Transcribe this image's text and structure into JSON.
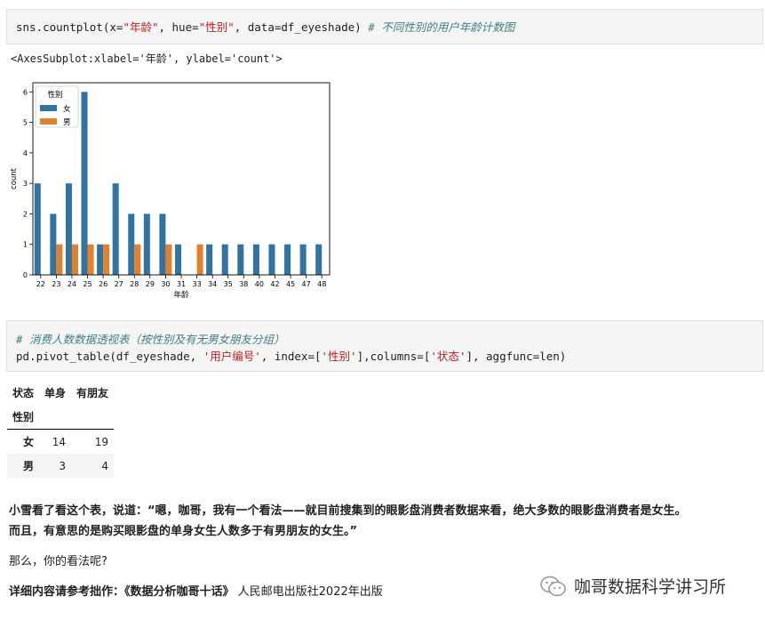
{
  "cell1": {
    "code_prefix": "sns.countplot(x=",
    "str_x": "\"年龄\"",
    "code_mid1": ", hue=",
    "str_hue": "\"性别\"",
    "code_mid2": ", data=df_eyeshade) ",
    "comment": "# 不同性别的用户年龄计数图"
  },
  "output1": "<AxesSubplot:xlabel='年龄', ylabel='count'>",
  "chart_data": {
    "type": "bar",
    "categories": [
      "22",
      "23",
      "24",
      "25",
      "26",
      "27",
      "28",
      "29",
      "30",
      "31",
      "33",
      "34",
      "35",
      "38",
      "40",
      "42",
      "45",
      "47",
      "48"
    ],
    "series": [
      {
        "name": "女",
        "color": "#3274a1",
        "values": [
          3,
          2,
          3,
          6,
          1,
          3,
          2,
          2,
          2,
          1,
          0,
          1,
          1,
          1,
          1,
          1,
          1,
          1,
          1
        ]
      },
      {
        "name": "男",
        "color": "#e1812c",
        "values": [
          0,
          1,
          1,
          1,
          1,
          0,
          1,
          0,
          1,
          0,
          1,
          0,
          0,
          0,
          0,
          0,
          0,
          0,
          0
        ]
      }
    ],
    "xlabel": "年龄",
    "ylabel": "count",
    "ylim": [
      0,
      6.3
    ],
    "yticks": [
      0,
      1,
      2,
      3,
      4,
      5,
      6
    ],
    "legend_title": "性别",
    "legend_position": "top-left",
    "grid": false
  },
  "cell2": {
    "comment": "# 消费人数数据透视表（按性别及有无男女朋友分组）",
    "code_prefix": "pd.pivot_table(df_eyeshade, ",
    "str1": "'用户编号'",
    "code_mid1": ", index=[",
    "str2": "'性别'",
    "code_mid2": "],columns=[",
    "str3": "'状态'",
    "code_mid3": "], aggfunc=len)"
  },
  "pivot": {
    "columns_name": "状态",
    "col1": "单身",
    "col2": "有朋友",
    "index_name": "性别",
    "rows": [
      {
        "label": "女",
        "v1": "14",
        "v2": "19"
      },
      {
        "label": "男",
        "v1": "3",
        "v2": "4"
      }
    ]
  },
  "text": {
    "para1_line1": "小雪看了看这个表，说道：“嗯，咖哥，我有一个看法——就目前搜集到的眼影盘消费者数据来看，绝大多数的眼影盘消费者是女生。",
    "para1_line2": "而且，有意思的是购买眼影盘的单身女生人数多于有男朋友的女生。”",
    "para2": "那么，你的看法呢?",
    "para3_bold": "详细内容请参考拙作：《数据分析咖哥十话》",
    "para3_rest": " 人民邮电出版社2022年出版"
  },
  "watermark": "咖哥数据科学讲习所"
}
